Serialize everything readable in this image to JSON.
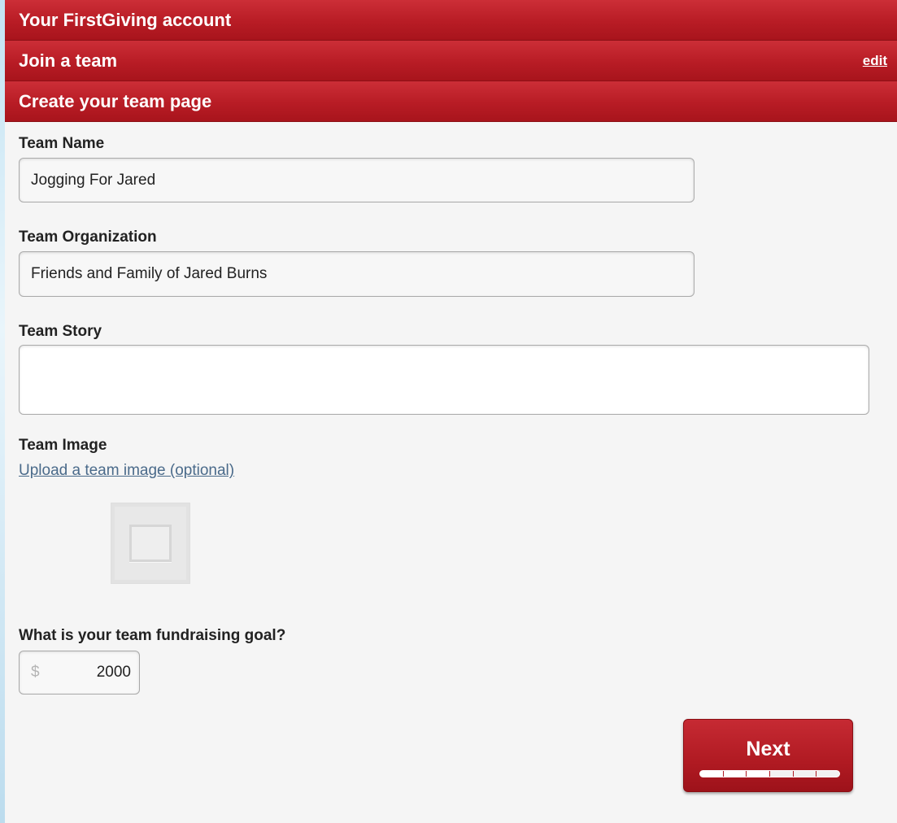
{
  "steps": {
    "account": {
      "title": "Your FirstGiving account"
    },
    "join_team": {
      "title": "Join a team",
      "edit_label": "edit"
    },
    "create_page": {
      "title": "Create your team page"
    }
  },
  "form": {
    "team_name": {
      "label": "Team Name",
      "value": "Jogging For Jared"
    },
    "team_org": {
      "label": "Team Organization",
      "value": "Friends and Family of Jared Burns"
    },
    "team_story": {
      "label": "Team Story",
      "value": ""
    },
    "team_image": {
      "label": "Team Image",
      "upload_link": "Upload a team image (optional)",
      "placeholder_icon": "image-placeholder-icon"
    },
    "goal": {
      "label": "What is your team fundraising goal?",
      "currency": "$",
      "value": "2000"
    }
  },
  "next_button": {
    "label": "Next",
    "progress_steps": 6,
    "progress_completed": 3
  },
  "colors": {
    "brand_red": "#b81c25",
    "link": "#4a6a8a"
  }
}
